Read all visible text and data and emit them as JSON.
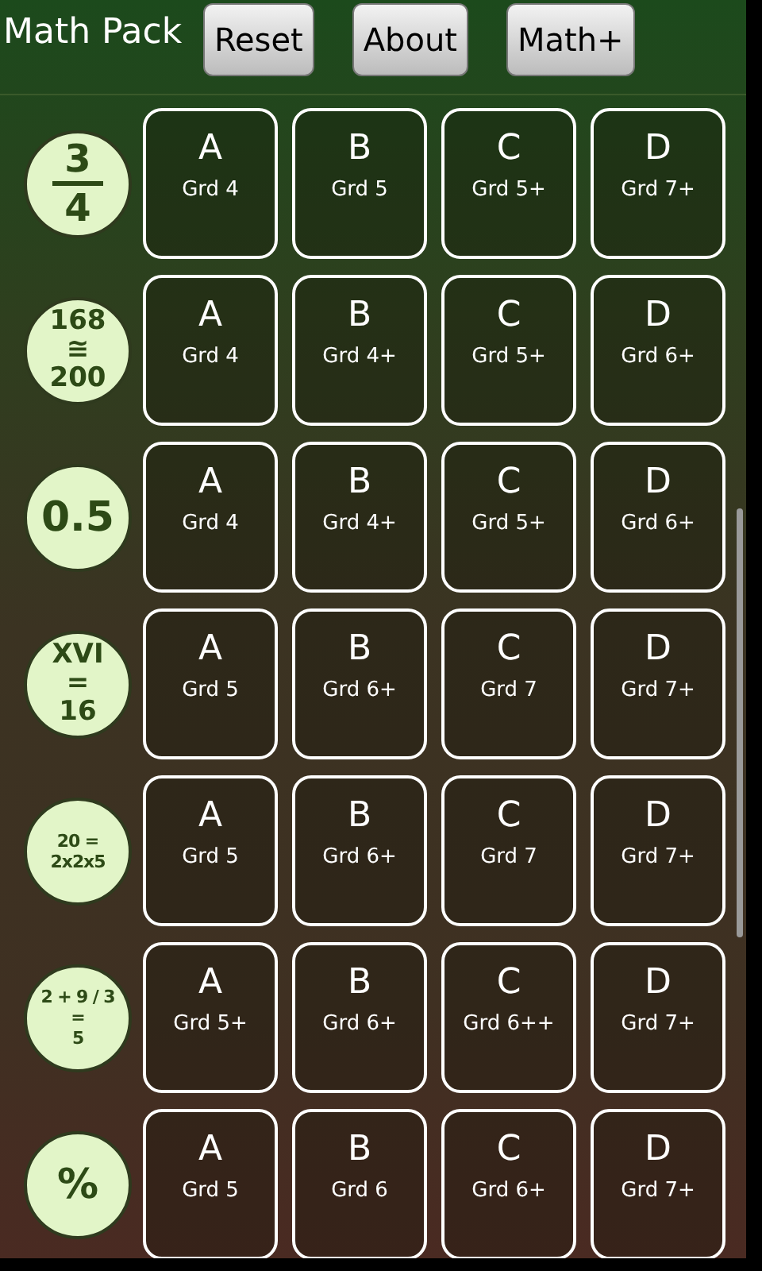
{
  "app_title": "Math Pack",
  "buttons": [
    "Reset",
    "About",
    "Math+"
  ],
  "rows": [
    {
      "badge": {
        "kind": "fraction",
        "lines": [
          "3",
          "4"
        ]
      },
      "levels": [
        {
          "letter": "A",
          "grade": "Grd 4"
        },
        {
          "letter": "B",
          "grade": "Grd 5"
        },
        {
          "letter": "C",
          "grade": "Grd 5+"
        },
        {
          "letter": "D",
          "grade": "Grd 7+"
        }
      ]
    },
    {
      "badge": {
        "kind": "stack",
        "lines": [
          "168",
          "≅",
          "200"
        ]
      },
      "levels": [
        {
          "letter": "A",
          "grade": "Grd 4"
        },
        {
          "letter": "B",
          "grade": "Grd 4+"
        },
        {
          "letter": "C",
          "grade": "Grd 5+"
        },
        {
          "letter": "D",
          "grade": "Grd 6+"
        }
      ]
    },
    {
      "badge": {
        "kind": "single",
        "lines": [
          "0.5"
        ]
      },
      "levels": [
        {
          "letter": "A",
          "grade": "Grd 4"
        },
        {
          "letter": "B",
          "grade": "Grd 4+"
        },
        {
          "letter": "C",
          "grade": "Grd 5+"
        },
        {
          "letter": "D",
          "grade": "Grd 6+"
        }
      ]
    },
    {
      "badge": {
        "kind": "stack",
        "lines": [
          "XVI",
          "=",
          "16"
        ]
      },
      "levels": [
        {
          "letter": "A",
          "grade": "Grd 5"
        },
        {
          "letter": "B",
          "grade": "Grd 6+"
        },
        {
          "letter": "C",
          "grade": "Grd 7"
        },
        {
          "letter": "D",
          "grade": "Grd 7+"
        }
      ]
    },
    {
      "badge": {
        "kind": "stack",
        "lines": [
          "20 =",
          "2x2x5"
        ]
      },
      "levels": [
        {
          "letter": "A",
          "grade": "Grd 5"
        },
        {
          "letter": "B",
          "grade": "Grd 6+"
        },
        {
          "letter": "C",
          "grade": "Grd 7"
        },
        {
          "letter": "D",
          "grade": "Grd 7+"
        }
      ]
    },
    {
      "badge": {
        "kind": "stack",
        "lines": [
          "2 + 9 / 3",
          "=",
          "5"
        ]
      },
      "levels": [
        {
          "letter": "A",
          "grade": "Grd 5+"
        },
        {
          "letter": "B",
          "grade": "Grd 6+"
        },
        {
          "letter": "C",
          "grade": "Grd 6++"
        },
        {
          "letter": "D",
          "grade": "Grd 7+"
        }
      ]
    },
    {
      "badge": {
        "kind": "single",
        "lines": [
          "%"
        ]
      },
      "levels": [
        {
          "letter": "A",
          "grade": "Grd 5"
        },
        {
          "letter": "B",
          "grade": "Grd 6"
        },
        {
          "letter": "C",
          "grade": "Grd 6+"
        },
        {
          "letter": "D",
          "grade": "Grd 7+"
        }
      ]
    }
  ]
}
